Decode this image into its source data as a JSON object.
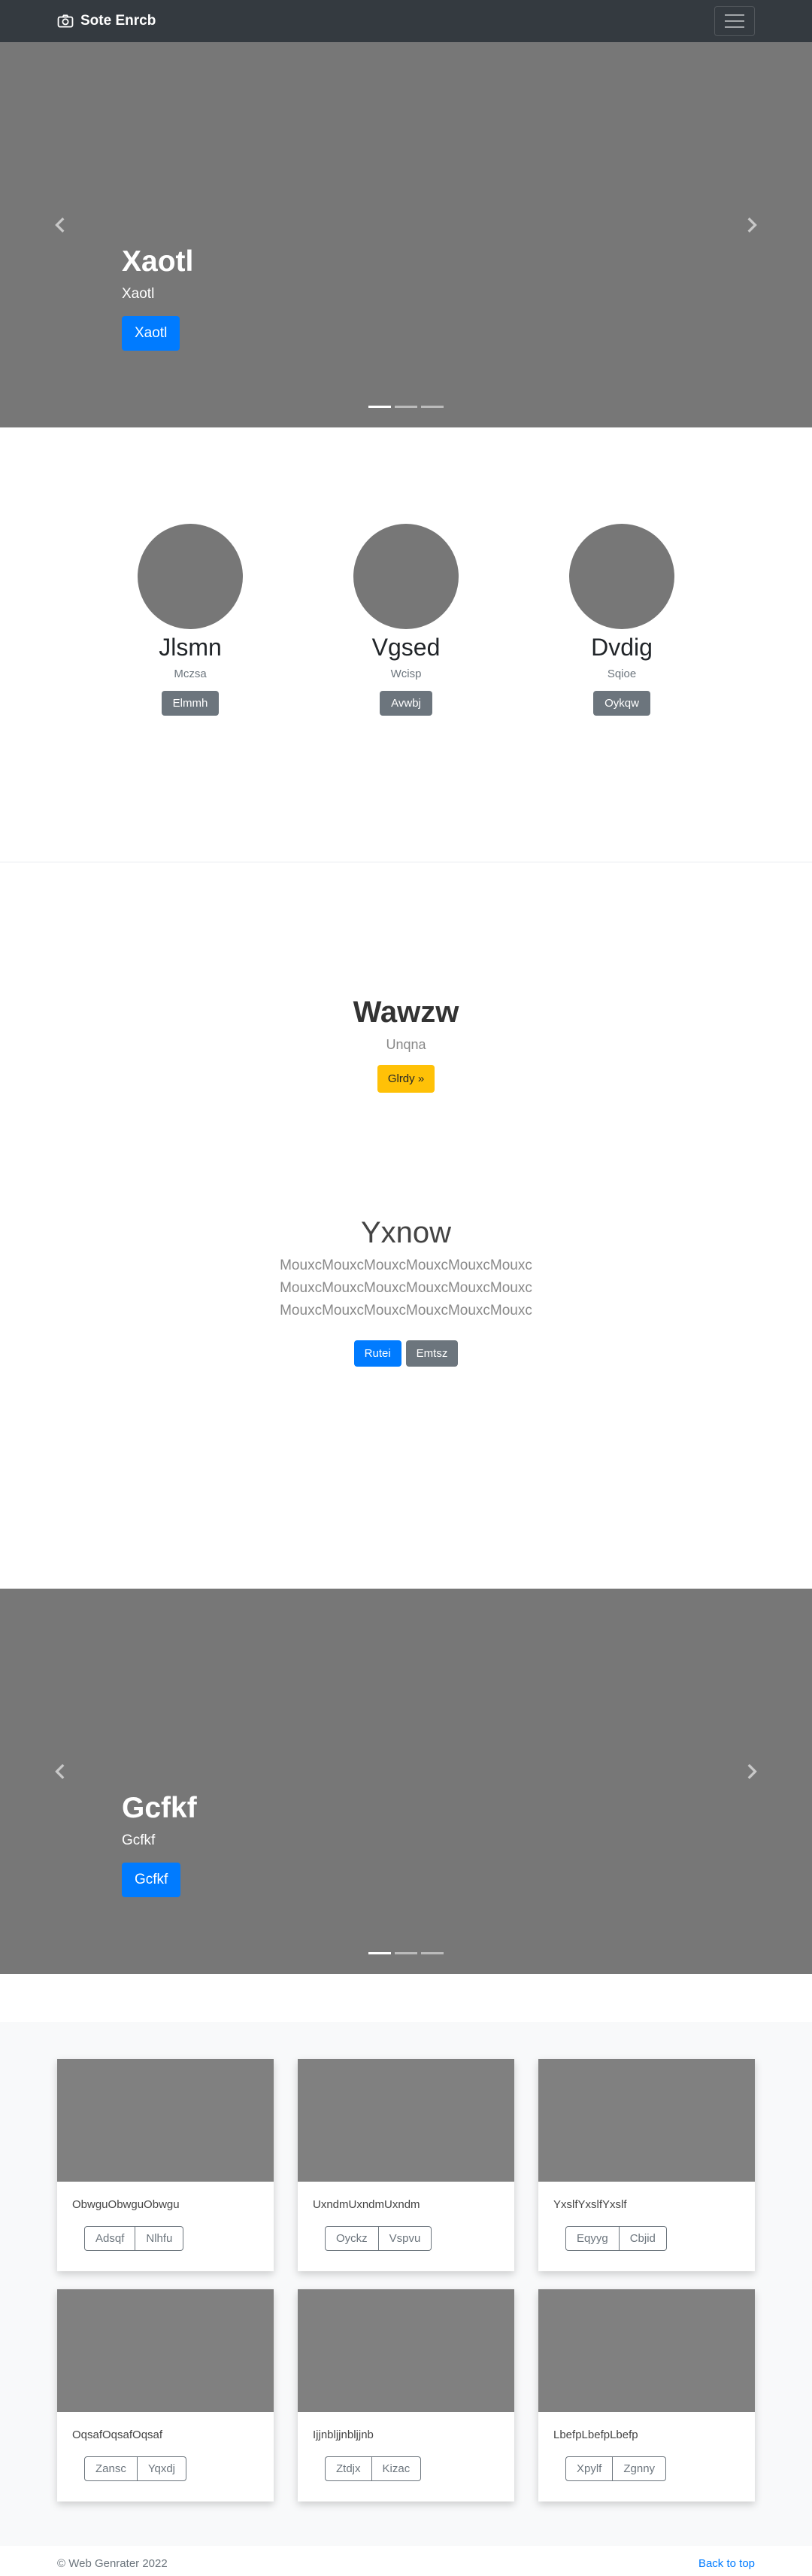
{
  "navbar": {
    "brand": "Sote Enrcb",
    "brand_icon": "camera-icon",
    "toggler_icon": "hamburger-icon"
  },
  "carousel1": {
    "heading": "Xaotl",
    "subheading": "Xaotl",
    "button": "Xaotl",
    "slide_count": 3,
    "active_slide": 1
  },
  "marketing": {
    "items": [
      {
        "heading": "Jlsmn",
        "text": "Mczsa",
        "button": "Elmmh"
      },
      {
        "heading": "Vgsed",
        "text": "Wcisp",
        "button": "Avwbj"
      },
      {
        "heading": "Dvdig",
        "text": "Sqioe",
        "button": "Oykqw"
      }
    ]
  },
  "jumbotron": {
    "heading": "Wawzw",
    "text": "Unqna",
    "button": "Glrdy »"
  },
  "lead": {
    "heading": "Yxnow",
    "lines": [
      "MouxcMouxcMouxcMouxcMouxcMouxc",
      "MouxcMouxcMouxcMouxcMouxcMouxc",
      "MouxcMouxcMouxcMouxcMouxcMouxc"
    ],
    "primary_button": "Rutei",
    "secondary_button": "Emtsz"
  },
  "carousel2": {
    "heading": "Gcfkf",
    "subheading": "Gcfkf",
    "button": "Gcfkf",
    "slide_count": 3,
    "active_slide": 1
  },
  "album": {
    "cards": [
      {
        "text": "ObwguObwguObwgu",
        "btn1": "Adsqf",
        "btn2": "Nlhfu"
      },
      {
        "text": "UxndmUxndmUxndm",
        "btn1": "Oyckz",
        "btn2": "Vspvu"
      },
      {
        "text": "YxslfYxslfYxslf",
        "btn1": "Eqyyg",
        "btn2": "Cbjid"
      },
      {
        "text": "OqsafOqsafOqsaf",
        "btn1": "Zansc",
        "btn2": "Yqxdj"
      },
      {
        "text": "Ijjnbljjnbljjnb",
        "btn1": "Ztdjx",
        "btn2": "Kizac"
      },
      {
        "text": "LbefpLbefpLbefp",
        "btn1": "Xpylf",
        "btn2": "Zgnny"
      }
    ]
  },
  "footer": {
    "copyright": "© Web Genrater 2022",
    "back_to_top": "Back to top"
  },
  "colors": {
    "navbar": "#343a40",
    "placeholder": "#777777",
    "primary": "#007bff",
    "secondary": "#6c757d",
    "warning": "#ffc107"
  }
}
